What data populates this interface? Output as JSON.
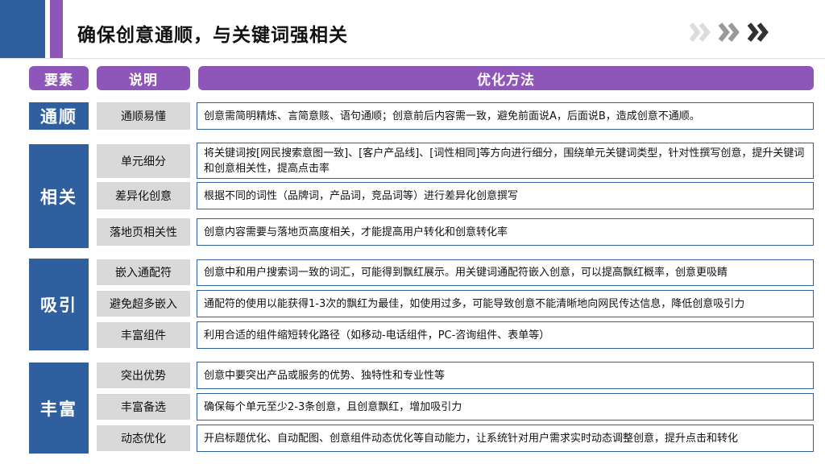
{
  "title": "确保创意通顺，与关键词强相关",
  "colors": {
    "blue": "#2f5f9e",
    "purple": "#8e56b8",
    "sub_bg": "#d9d9d9",
    "chevron_light": "#d9d9d9",
    "chevron_mid": "#9a9a9a",
    "chevron_dark": "#3a3a3a"
  },
  "icons": [
    "chevron-right-light-icon",
    "chevron-right-mid-icon",
    "chevron-right-dark-icon"
  ],
  "headers": {
    "col1": "要素",
    "col2": "说明",
    "col3": "优化方法"
  },
  "groups": [
    {
      "name": "通顺",
      "rows": [
        {
          "item": "通顺易懂",
          "method": "创意需简明精炼、言简意赅、语句通顺；创意前后内容需一致，避免前面说A，后面说B，造成创意不通顺。"
        }
      ]
    },
    {
      "name": "相关",
      "rows": [
        {
          "item": "单元细分",
          "method": "将关键词按[网民搜索意图一致]、[客户产品线]、[词性相同]等方向进行细分，围绕单元关键词类型，针对性撰写创意，提升关键词和创意相关性，提高点击率"
        },
        {
          "item": "差异化创意",
          "method": "根据不同的词性（品牌词，产品词，竞品词等）进行差异化创意撰写"
        },
        {
          "item": "落地页相关性",
          "method": "创意内容需要与落地页高度相关，才能提高用户转化和创意转化率"
        }
      ]
    },
    {
      "name": "吸引",
      "rows": [
        {
          "item": "嵌入通配符",
          "method": "创意中和用户搜索词一致的词汇，可能得到飘红展示。用关键词通配符嵌入创意，可以提高飘红概率，创意更吸睛"
        },
        {
          "item": "避免超多嵌入",
          "method": "通配符的使用以能获得1-3次的飘红为最佳，如使用过多，可能导致创意不能清晰地向网民传达信息，降低创意吸引力"
        },
        {
          "item": "丰富组件",
          "method": "利用合适的组件缩短转化路径（如移动-电话组件，PC-咨询组件、表单等）"
        }
      ]
    },
    {
      "name": "丰富",
      "rows": [
        {
          "item": "突出优势",
          "method": "创意中要突出产品或服务的优势、独特性和专业性等"
        },
        {
          "item": "丰富备选",
          "method": "确保每个单元至少2-3条创意，且创意飘红，增加吸引力"
        },
        {
          "item": "动态优化",
          "method": "开启标题优化、自动配图、创意组件动态优化等自动能力，让系统针对用户需求实时动态调整创意，提升点击和转化"
        }
      ]
    }
  ]
}
